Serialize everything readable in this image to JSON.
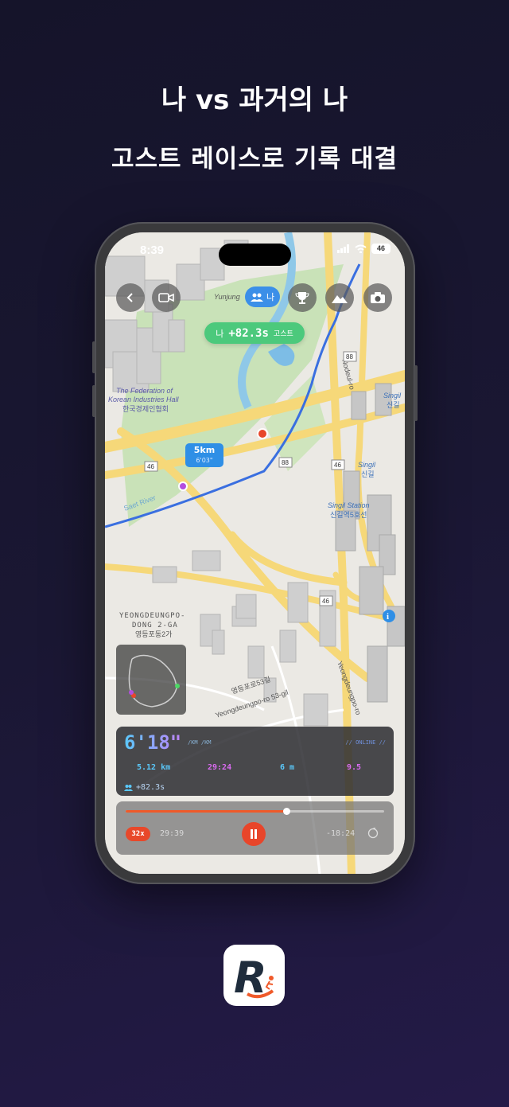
{
  "headline": {
    "line1": "나 vs 과거의 나",
    "line2": "고스트 레이스로 기록 대결"
  },
  "status_bar": {
    "time": "8:39",
    "battery": "46"
  },
  "map": {
    "labels": {
      "yunjung": "Yunjung",
      "federation_en_1": "The Federation of",
      "federation_en_2": "Korean Industries Hall",
      "federation_ko": "한국경제인협회",
      "singil": "Singil",
      "singil_ko": "신길",
      "singil_station_en": "Singil Station",
      "singil_station_ko": "신길역5호선",
      "yeongdeungpo_1": "YEONGDEUNGPO-",
      "yeongdeungpo_2": "DONG 2-GA",
      "yeongdeungpo_ko": "영등포동2가",
      "road_88_a": "88",
      "road_88_b": "88",
      "road_46_a": "46",
      "road_46_b": "46",
      "road_46_c": "46",
      "yeongdeungpo_ro": "Yeongdeungpo-ro",
      "road_53gil": "Yeongdeungpo-ro 53-gil",
      "road_53gil_ko": "영등포로53길",
      "nodeul": "Nodeul-ro",
      "saet": "Saet River"
    },
    "toggle_label": "나",
    "ghost_pill": {
      "me": "나",
      "diff": "+82.3s",
      "ghost": "고스트"
    },
    "km_marker": {
      "distance": "5km",
      "pace": "6'03\""
    },
    "colors": {
      "route": "#3a6fe0",
      "runner": "#e8462a",
      "ghost": "#b44ee0"
    }
  },
  "controls": {
    "back_icon": "chevron-left-icon",
    "video_icon": "video-camera-icon",
    "ghost_icon": "users-icon",
    "trophy_icon": "trophy-icon",
    "terrain_icon": "mountain-icon",
    "camera_icon": "camera-icon"
  },
  "stats": {
    "pace": "6'18\"",
    "pace_unit": "/KM /KM",
    "online": "// ONLINE //",
    "distance": "5.12 km",
    "time": "29:24",
    "elevation": "6 m",
    "cadence": "9.5",
    "ghost_diff": "+82.3s"
  },
  "player": {
    "speed": "32x",
    "elapsed": "29:39",
    "remaining": "-18:24",
    "progress": 0.62
  },
  "app_logo": "R"
}
